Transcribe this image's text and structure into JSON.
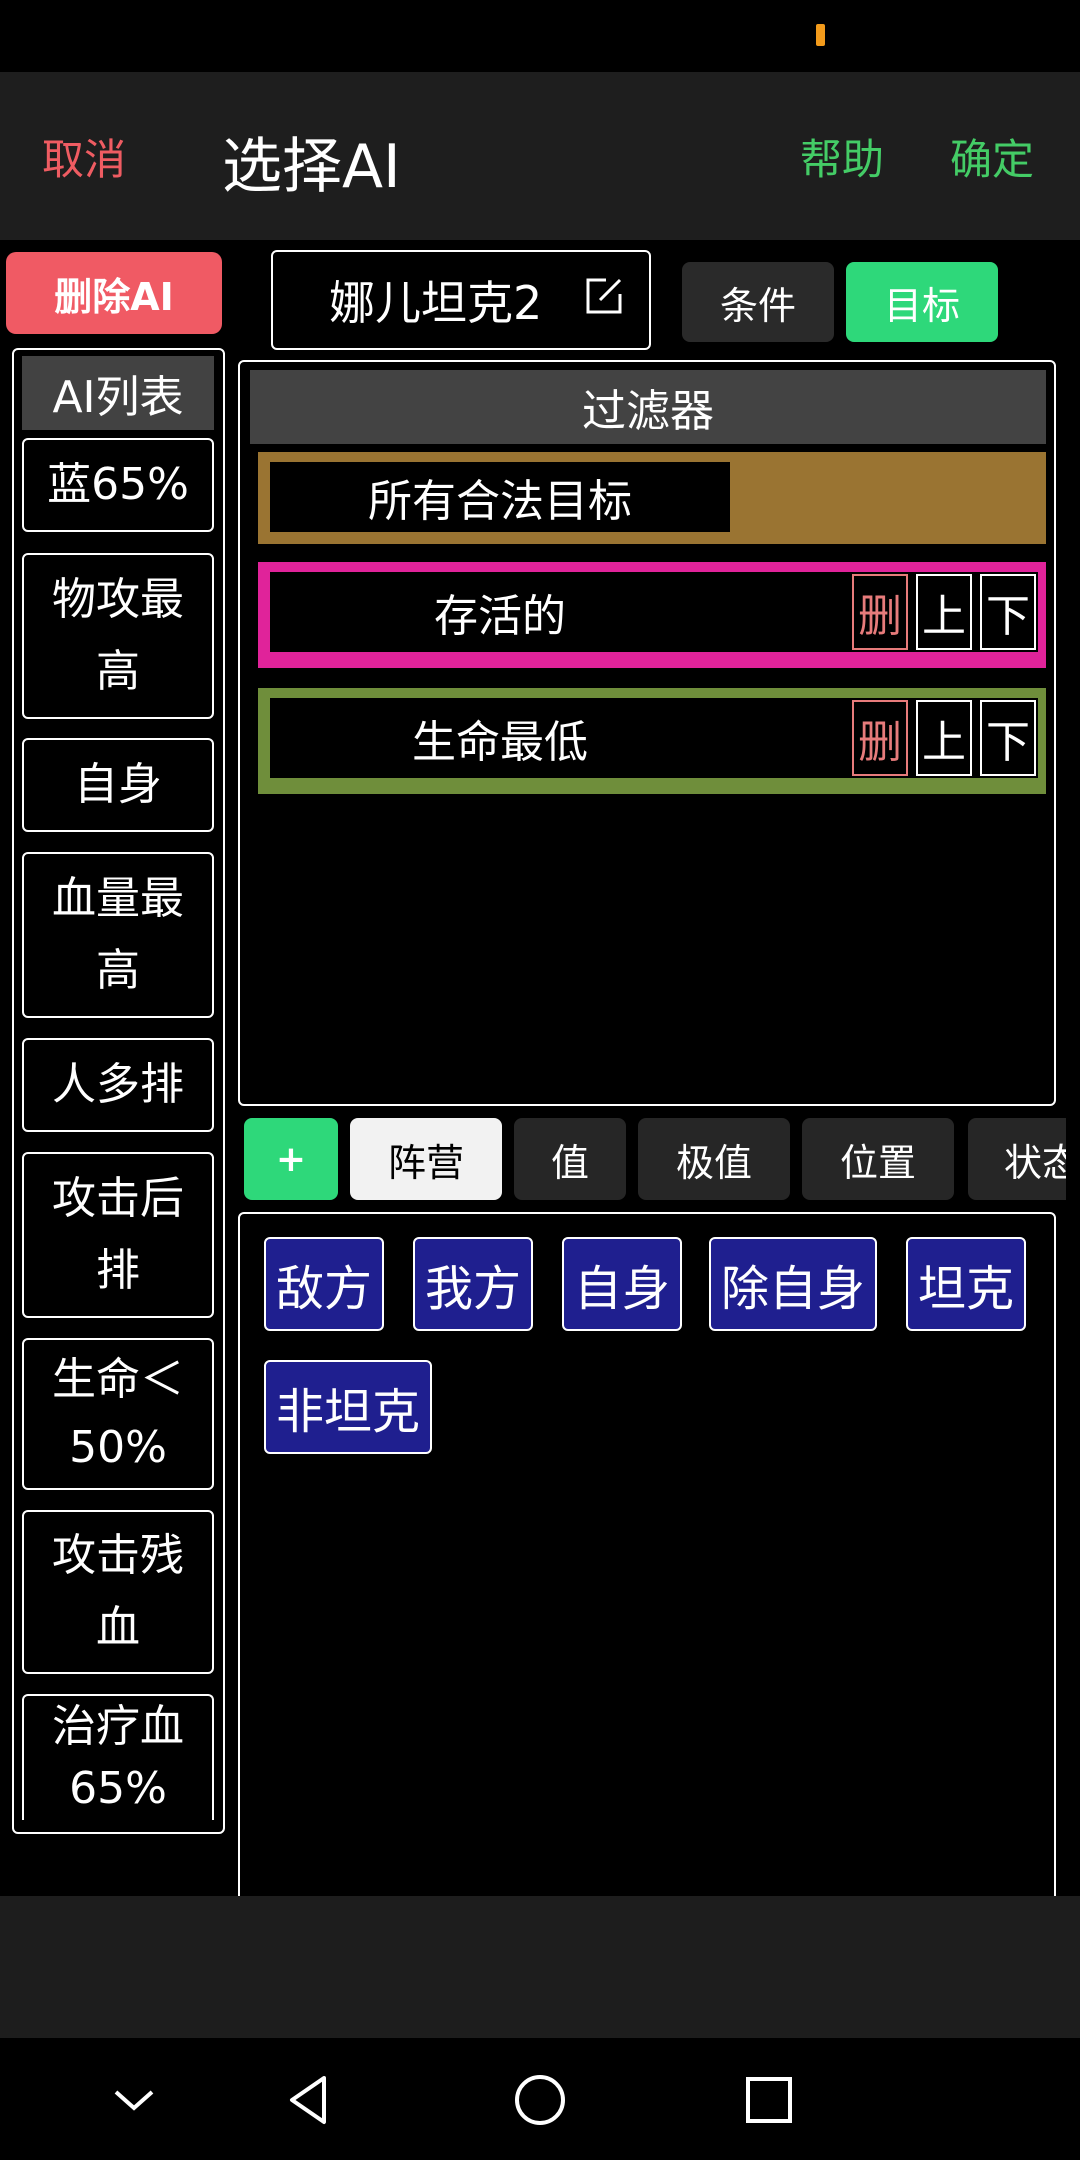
{
  "header": {
    "cancel": "取消",
    "title": "选择AI",
    "help": "帮助",
    "confirm": "确定"
  },
  "delete_ai": "删除AI",
  "ai_name": "娜儿坦克2",
  "tabs": {
    "condition": "条件",
    "target": "目标"
  },
  "ai_list": {
    "header": "AI列表",
    "items": [
      [
        "蓝65%"
      ],
      [
        "物攻最",
        "高"
      ],
      [
        "自身"
      ],
      [
        "血量最",
        "高"
      ],
      [
        "人多排"
      ],
      [
        "攻击后",
        "排"
      ],
      [
        "生命＜",
        "50%"
      ],
      [
        "攻击残",
        "血"
      ],
      [
        "治疗血",
        "65%"
      ]
    ]
  },
  "filter": {
    "title": "过滤器",
    "rows": [
      {
        "label": "所有合法目标",
        "color": "#9a7432"
      },
      {
        "label": "存活的",
        "color": "#e0239a"
      },
      {
        "label": "生命最低",
        "color": "#6f8e3b"
      }
    ],
    "buttons": {
      "delete": "删",
      "up": "上",
      "down": "下"
    }
  },
  "categories": {
    "add": "+",
    "items": [
      "阵营",
      "值",
      "极值",
      "位置",
      "状态"
    ],
    "selected": "阵营"
  },
  "options": [
    "敌方",
    "我方",
    "自身",
    "除自身",
    "坦克",
    "非坦克"
  ],
  "colors": {
    "accent_green": "#2ed87a",
    "danger_red": "#f05a64",
    "option_blue": "#1f1f8f"
  }
}
